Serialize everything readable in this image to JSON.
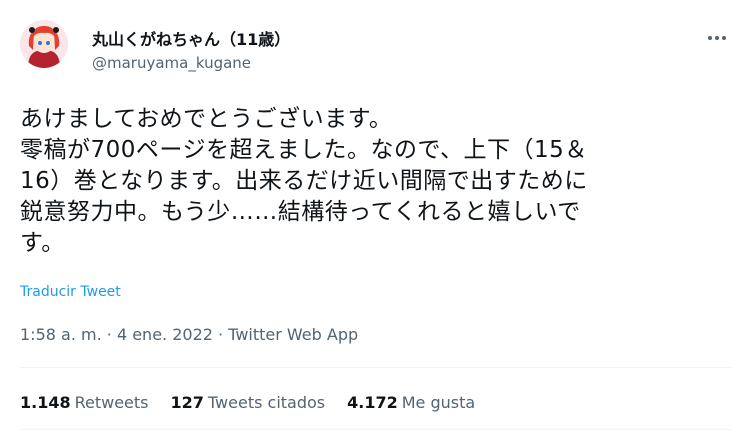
{
  "author": {
    "display_name": "丸山くがねちゃん（11歳）",
    "handle": "@maruyama_kugane"
  },
  "tweet": {
    "text": "あけましておめでとうございます。\n零稿が700ページを超えました。なので、上下（15＆\n16）巻となります。出来るだけ近い間隔で出すために\n鋭意努力中。もう少……結構待ってくれると嬉しいで\nす。",
    "translate_label": "Traducir Tweet"
  },
  "meta": {
    "time": "1:58 a. m.",
    "separator1": " · ",
    "date": "4 ene. 2022",
    "separator2": " · ",
    "source": "Twitter Web App"
  },
  "stats": {
    "retweets_count": "1.148",
    "retweets_label": "Retweets",
    "quotes_count": "127",
    "quotes_label": "Tweets citados",
    "likes_count": "4.172",
    "likes_label": "Me gusta"
  },
  "icons": {
    "more": "more-dots-icon"
  },
  "colors": {
    "link": "#1d9bf0",
    "secondary_text": "#536471",
    "primary_text": "#0f1419",
    "divider": "#eff3f4"
  }
}
